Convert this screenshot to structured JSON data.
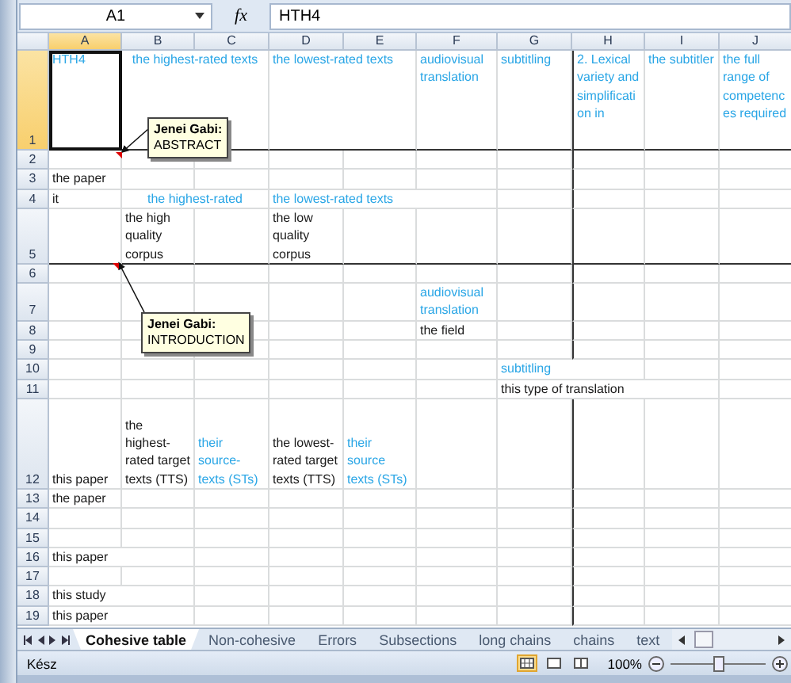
{
  "formula_bar": {
    "name_box": "A1",
    "function_label": "fx",
    "formula": "HTH4"
  },
  "columns": [
    {
      "label": "A",
      "selected": true
    },
    {
      "label": "B",
      "selected": false
    },
    {
      "label": "C",
      "selected": false
    },
    {
      "label": "D",
      "selected": false
    },
    {
      "label": "E",
      "selected": false
    },
    {
      "label": "F",
      "selected": false
    },
    {
      "label": "G",
      "selected": false
    },
    {
      "label": "H",
      "selected": false
    },
    {
      "label": "I",
      "selected": false
    },
    {
      "label": "J",
      "selected": false
    }
  ],
  "rows": [
    {
      "label": "1",
      "selected": true,
      "cells": [
        {
          "text": "HTH4",
          "color": "#2aa6e6",
          "selected": true
        },
        {
          "text": "the highest-rated texts",
          "color": "#2aa6e6",
          "merged": true
        },
        null,
        {
          "text": "the lowest-rated texts",
          "color": "#2aa6e6",
          "wrap": false
        },
        null,
        {
          "text": "audiovisual translation",
          "color": "#2aa6e6",
          "wrap": true
        },
        {
          "text": "subtitling",
          "color": "#2aa6e6"
        },
        {
          "text": "2. Lexical variety and simplification in",
          "color": "#2aa6e6",
          "wrap": true
        },
        {
          "text": "the subtitler",
          "color": "#2aa6e6",
          "wrap": true
        },
        {
          "text": "the full range of competences required",
          "color": "#2aa6e6",
          "wrap": true
        }
      ]
    },
    {
      "label": "2",
      "selected": false,
      "cells": [
        null,
        null,
        null,
        null,
        null,
        null,
        null,
        null,
        null,
        null
      ]
    },
    {
      "label": "3",
      "selected": false,
      "cells": [
        {
          "text": "the paper",
          "color": "#1a1a1a"
        },
        null,
        null,
        null,
        null,
        null,
        null,
        null,
        null,
        null
      ]
    },
    {
      "label": "4",
      "selected": false,
      "cells": [
        {
          "text": "it",
          "color": "#1a1a1a"
        },
        {
          "text": "the highest-rated",
          "color": "#2aa6e6",
          "merged": true
        },
        null,
        {
          "text": "the lowest-rated texts",
          "color": "#2aa6e6",
          "wrap": false
        },
        null,
        null,
        null,
        null,
        null,
        null
      ]
    },
    {
      "label": "5",
      "selected": false,
      "cells": [
        null,
        {
          "text": "the high quality corpus",
          "color": "#1a1a1a",
          "wrap": true
        },
        null,
        {
          "text": "the low quality corpus",
          "color": "#1a1a1a",
          "wrap": true
        },
        null,
        null,
        null,
        null,
        null,
        null
      ]
    },
    {
      "label": "6",
      "selected": false,
      "cells": [
        null,
        null,
        null,
        null,
        null,
        null,
        null,
        null,
        null,
        null
      ]
    },
    {
      "label": "7",
      "selected": false,
      "cells": [
        null,
        null,
        null,
        null,
        null,
        {
          "text": "audiovisual translation",
          "color": "#2aa6e6",
          "wrap": true
        },
        null,
        null,
        null,
        null
      ]
    },
    {
      "label": "8",
      "selected": false,
      "cells": [
        null,
        null,
        null,
        null,
        null,
        {
          "text": "the field",
          "color": "#1a1a1a"
        },
        null,
        null,
        null,
        null
      ]
    },
    {
      "label": "9",
      "selected": false,
      "cells": [
        null,
        null,
        null,
        null,
        null,
        null,
        null,
        null,
        null,
        null
      ]
    },
    {
      "label": "10",
      "selected": false,
      "cells": [
        null,
        null,
        null,
        null,
        null,
        null,
        {
          "text": "subtitling",
          "color": "#2aa6e6"
        },
        null,
        null,
        null
      ]
    },
    {
      "label": "11",
      "selected": false,
      "cells": [
        null,
        null,
        null,
        null,
        null,
        null,
        {
          "text": "this type of translation",
          "color": "#1a1a1a",
          "wrap": false
        },
        null,
        null,
        null
      ]
    },
    {
      "label": "12",
      "selected": false,
      "cells": [
        {
          "text": "this paper",
          "color": "#1a1a1a"
        },
        {
          "text": "the highest-rated target texts (TTS)",
          "color": "#1a1a1a",
          "wrap": true
        },
        {
          "text": "their source-texts (STs)",
          "color": "#2aa6e6",
          "wrap": true
        },
        {
          "text": "the lowest-rated target texts (TTS)",
          "color": "#1a1a1a",
          "wrap": true
        },
        {
          "text": "their source texts (STs)",
          "color": "#2aa6e6",
          "wrap": true
        },
        null,
        null,
        null,
        null,
        null
      ]
    },
    {
      "label": "13",
      "selected": false,
      "cells": [
        {
          "text": "the paper",
          "color": "#1a1a1a"
        },
        null,
        null,
        null,
        null,
        null,
        null,
        null,
        null,
        null
      ]
    },
    {
      "label": "14",
      "selected": false,
      "cells": [
        null,
        null,
        null,
        null,
        null,
        null,
        null,
        null,
        null,
        null
      ]
    },
    {
      "label": "15",
      "selected": false,
      "cells": [
        null,
        null,
        null,
        null,
        null,
        null,
        null,
        null,
        null,
        null
      ]
    },
    {
      "label": "16",
      "selected": false,
      "cells": [
        {
          "text": "this paper",
          "color": "#1a1a1a",
          "wrap": false
        },
        null,
        null,
        null,
        null,
        null,
        null,
        null,
        null,
        null
      ]
    },
    {
      "label": "17",
      "selected": false,
      "cells": [
        null,
        null,
        null,
        null,
        null,
        null,
        null,
        null,
        null,
        null
      ]
    },
    {
      "label": "18",
      "selected": false,
      "cells": [
        {
          "text": "this study",
          "color": "#1a1a1a",
          "wrap": false
        },
        null,
        null,
        null,
        null,
        null,
        null,
        null,
        null,
        null
      ]
    },
    {
      "label": "19",
      "selected": false,
      "cells": [
        {
          "text": "this paper",
          "color": "#1a1a1a",
          "wrap": false
        },
        null,
        null,
        null,
        null,
        null,
        null,
        null,
        null,
        null
      ]
    }
  ],
  "comments": [
    {
      "author": "Jenei Gabi:",
      "text": "ABSTRACT"
    },
    {
      "author": "Jenei Gabi:",
      "text": "INTRODUCTION"
    }
  ],
  "sheet_tabs": [
    {
      "label": "Cohesive table",
      "selected": true
    },
    {
      "label": "Non-cohesive",
      "selected": false
    },
    {
      "label": "Errors",
      "selected": false
    },
    {
      "label": "Subsections",
      "selected": false
    },
    {
      "label": "long chains",
      "selected": false
    },
    {
      "label": "chains",
      "selected": false
    },
    {
      "label": "text",
      "selected": false
    }
  ],
  "status_bar": {
    "text": "Kész",
    "views": [
      {
        "kind": "normal",
        "selected": true
      },
      {
        "kind": "layout",
        "selected": false
      },
      {
        "kind": "pagebreak",
        "selected": false
      }
    ],
    "zoom": "100%",
    "zoom_slider": {
      "level": 0.5
    }
  }
}
